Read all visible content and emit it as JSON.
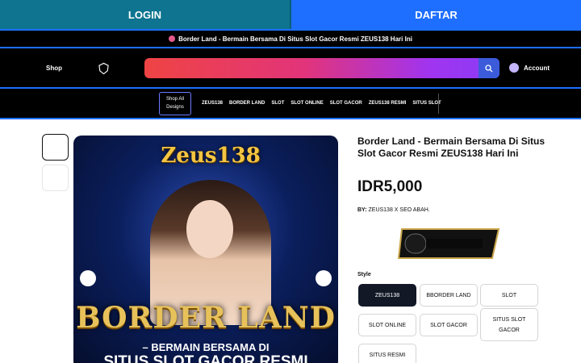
{
  "top_buttons": {
    "login": "LOGIN",
    "daftar": "DAFTAR"
  },
  "colors": {
    "login_bg": "#0e7490",
    "daftar_bg": "#1e6fff",
    "header_bg": "#000000",
    "accent": "#1e6fff"
  },
  "announcement": "Border Land - Bermain Bersama Di Situs Slot Gacor Resmi ZEUS138 Hari Ini",
  "header": {
    "shop_label": "Shop",
    "search_placeholder": "",
    "account_label": "Account"
  },
  "nav": {
    "shop_all_line1": "Shop All",
    "shop_all_line2": "Designs",
    "links": [
      "ZEUS138",
      "BORDER LAND",
      "SLOT",
      "SLOT ONLINE",
      "SLOT GACOR",
      "ZEUS138 RESMI",
      "SITUS SLOT"
    ]
  },
  "hero": {
    "logo_text": "Zeus138",
    "headline": "BORDER LAND",
    "sub1": "– BERMAIN BERSAMA DI",
    "sub2": "SITUS SLOT GACOR RESMI"
  },
  "product": {
    "title": "Border Land - Bermain Bersama Di Situs Slot Gacor Resmi ZEUS138 Hari Ini",
    "price": "IDR5,000",
    "by_label": "BY:",
    "by_value": "ZEUS138 X SEO ABAH.",
    "style_label": "Style",
    "style_options": [
      "ZEUS138",
      "BBORDER LAND",
      "SLOT",
      "SLOT ONLINE",
      "SLOT GACOR",
      "SITUS SLOT GACOR",
      "SITUS RESMI"
    ],
    "selected_style": "ZEUS138"
  }
}
